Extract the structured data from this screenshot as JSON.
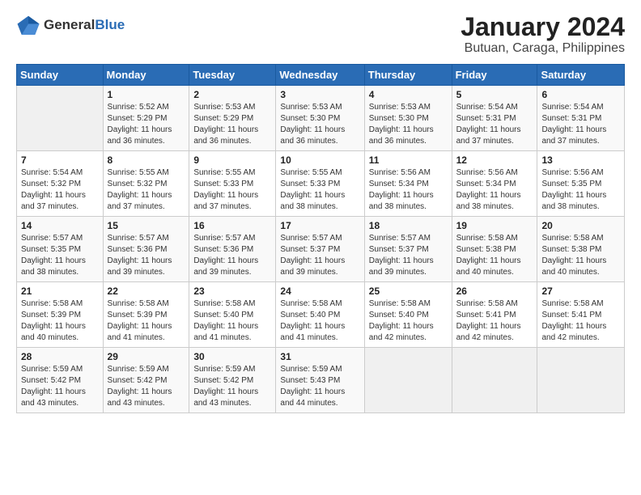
{
  "header": {
    "logo_general": "General",
    "logo_blue": "Blue",
    "title": "January 2024",
    "subtitle": "Butuan, Caraga, Philippines"
  },
  "calendar": {
    "days_of_week": [
      "Sunday",
      "Monday",
      "Tuesday",
      "Wednesday",
      "Thursday",
      "Friday",
      "Saturday"
    ],
    "weeks": [
      [
        {
          "day": "",
          "info": ""
        },
        {
          "day": "1",
          "info": "Sunrise: 5:52 AM\nSunset: 5:29 PM\nDaylight: 11 hours\nand 36 minutes."
        },
        {
          "day": "2",
          "info": "Sunrise: 5:53 AM\nSunset: 5:29 PM\nDaylight: 11 hours\nand 36 minutes."
        },
        {
          "day": "3",
          "info": "Sunrise: 5:53 AM\nSunset: 5:30 PM\nDaylight: 11 hours\nand 36 minutes."
        },
        {
          "day": "4",
          "info": "Sunrise: 5:53 AM\nSunset: 5:30 PM\nDaylight: 11 hours\nand 36 minutes."
        },
        {
          "day": "5",
          "info": "Sunrise: 5:54 AM\nSunset: 5:31 PM\nDaylight: 11 hours\nand 37 minutes."
        },
        {
          "day": "6",
          "info": "Sunrise: 5:54 AM\nSunset: 5:31 PM\nDaylight: 11 hours\nand 37 minutes."
        }
      ],
      [
        {
          "day": "7",
          "info": "Sunrise: 5:54 AM\nSunset: 5:32 PM\nDaylight: 11 hours\nand 37 minutes."
        },
        {
          "day": "8",
          "info": "Sunrise: 5:55 AM\nSunset: 5:32 PM\nDaylight: 11 hours\nand 37 minutes."
        },
        {
          "day": "9",
          "info": "Sunrise: 5:55 AM\nSunset: 5:33 PM\nDaylight: 11 hours\nand 37 minutes."
        },
        {
          "day": "10",
          "info": "Sunrise: 5:55 AM\nSunset: 5:33 PM\nDaylight: 11 hours\nand 38 minutes."
        },
        {
          "day": "11",
          "info": "Sunrise: 5:56 AM\nSunset: 5:34 PM\nDaylight: 11 hours\nand 38 minutes."
        },
        {
          "day": "12",
          "info": "Sunrise: 5:56 AM\nSunset: 5:34 PM\nDaylight: 11 hours\nand 38 minutes."
        },
        {
          "day": "13",
          "info": "Sunrise: 5:56 AM\nSunset: 5:35 PM\nDaylight: 11 hours\nand 38 minutes."
        }
      ],
      [
        {
          "day": "14",
          "info": "Sunrise: 5:57 AM\nSunset: 5:35 PM\nDaylight: 11 hours\nand 38 minutes."
        },
        {
          "day": "15",
          "info": "Sunrise: 5:57 AM\nSunset: 5:36 PM\nDaylight: 11 hours\nand 39 minutes."
        },
        {
          "day": "16",
          "info": "Sunrise: 5:57 AM\nSunset: 5:36 PM\nDaylight: 11 hours\nand 39 minutes."
        },
        {
          "day": "17",
          "info": "Sunrise: 5:57 AM\nSunset: 5:37 PM\nDaylight: 11 hours\nand 39 minutes."
        },
        {
          "day": "18",
          "info": "Sunrise: 5:57 AM\nSunset: 5:37 PM\nDaylight: 11 hours\nand 39 minutes."
        },
        {
          "day": "19",
          "info": "Sunrise: 5:58 AM\nSunset: 5:38 PM\nDaylight: 11 hours\nand 40 minutes."
        },
        {
          "day": "20",
          "info": "Sunrise: 5:58 AM\nSunset: 5:38 PM\nDaylight: 11 hours\nand 40 minutes."
        }
      ],
      [
        {
          "day": "21",
          "info": "Sunrise: 5:58 AM\nSunset: 5:39 PM\nDaylight: 11 hours\nand 40 minutes."
        },
        {
          "day": "22",
          "info": "Sunrise: 5:58 AM\nSunset: 5:39 PM\nDaylight: 11 hours\nand 41 minutes."
        },
        {
          "day": "23",
          "info": "Sunrise: 5:58 AM\nSunset: 5:40 PM\nDaylight: 11 hours\nand 41 minutes."
        },
        {
          "day": "24",
          "info": "Sunrise: 5:58 AM\nSunset: 5:40 PM\nDaylight: 11 hours\nand 41 minutes."
        },
        {
          "day": "25",
          "info": "Sunrise: 5:58 AM\nSunset: 5:40 PM\nDaylight: 11 hours\nand 42 minutes."
        },
        {
          "day": "26",
          "info": "Sunrise: 5:58 AM\nSunset: 5:41 PM\nDaylight: 11 hours\nand 42 minutes."
        },
        {
          "day": "27",
          "info": "Sunrise: 5:58 AM\nSunset: 5:41 PM\nDaylight: 11 hours\nand 42 minutes."
        }
      ],
      [
        {
          "day": "28",
          "info": "Sunrise: 5:59 AM\nSunset: 5:42 PM\nDaylight: 11 hours\nand 43 minutes."
        },
        {
          "day": "29",
          "info": "Sunrise: 5:59 AM\nSunset: 5:42 PM\nDaylight: 11 hours\nand 43 minutes."
        },
        {
          "day": "30",
          "info": "Sunrise: 5:59 AM\nSunset: 5:42 PM\nDaylight: 11 hours\nand 43 minutes."
        },
        {
          "day": "31",
          "info": "Sunrise: 5:59 AM\nSunset: 5:43 PM\nDaylight: 11 hours\nand 44 minutes."
        },
        {
          "day": "",
          "info": ""
        },
        {
          "day": "",
          "info": ""
        },
        {
          "day": "",
          "info": ""
        }
      ]
    ]
  }
}
